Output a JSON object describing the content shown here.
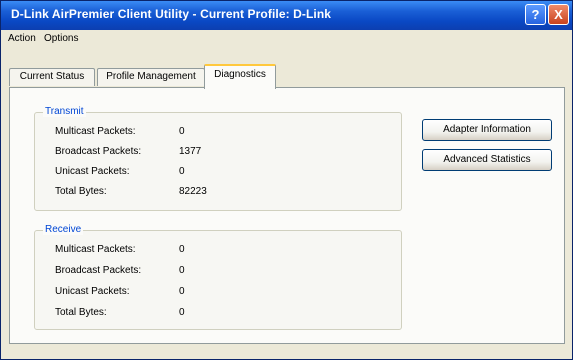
{
  "window": {
    "title": "D-Link AirPremier Client Utility - Current Profile: D-Link",
    "help_button": "?",
    "close_button": "X"
  },
  "menu": {
    "items": [
      {
        "label": "Action"
      },
      {
        "label": "Options"
      }
    ]
  },
  "tabs": [
    {
      "label": "Current Status",
      "active": false
    },
    {
      "label": "Profile Management",
      "active": false
    },
    {
      "label": "Diagnostics",
      "active": true
    }
  ],
  "transmit": {
    "title": "Transmit",
    "rows": [
      {
        "label": "Multicast Packets:",
        "value": "0"
      },
      {
        "label": "Broadcast Packets:",
        "value": "1377"
      },
      {
        "label": "Unicast Packets:",
        "value": "0"
      },
      {
        "label": "Total Bytes:",
        "value": "82223"
      }
    ]
  },
  "receive": {
    "title": "Receive",
    "rows": [
      {
        "label": "Multicast Packets:",
        "value": "0"
      },
      {
        "label": "Broadcast Packets:",
        "value": "0"
      },
      {
        "label": "Unicast Packets:",
        "value": "0"
      },
      {
        "label": "Total Bytes:",
        "value": "0"
      }
    ]
  },
  "buttons": {
    "adapter_information": "Adapter Information",
    "advanced_statistics": "Advanced Statistics"
  },
  "colors": {
    "titlebar": "#0a48c4",
    "group_title": "#0046d5",
    "active_tab_accent": "#ffc83c"
  }
}
